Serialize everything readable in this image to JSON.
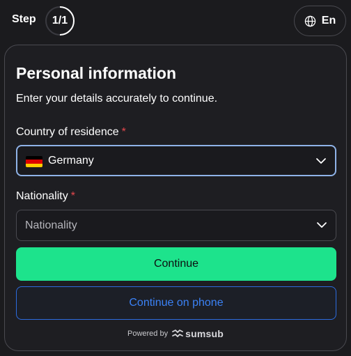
{
  "header": {
    "step_label": "Step",
    "step_count": "1/1",
    "step_progress": 1,
    "language": {
      "icon": "globe-icon",
      "label": "En"
    }
  },
  "card": {
    "title": "Personal information",
    "subtitle": "Enter your details accurately to continue.",
    "country_field": {
      "label": "Country of residence",
      "required_mark": "*",
      "value": "Germany",
      "flag_icon": "germany-flag-icon",
      "flag_colors": [
        "#000000",
        "#dd0000",
        "#ffce00"
      ]
    },
    "nationality_field": {
      "label": "Nationality",
      "required_mark": "*",
      "placeholder": "Nationality"
    },
    "continue_label": "Continue",
    "continue_phone_label": "Continue on phone",
    "footer": {
      "powered_by": "Powered by",
      "brand": "sumsub"
    }
  },
  "colors": {
    "accent_green": "#1de38c",
    "accent_blue": "#3b82f6",
    "focus_border": "#8fb3e8",
    "required": "#e5484d"
  }
}
